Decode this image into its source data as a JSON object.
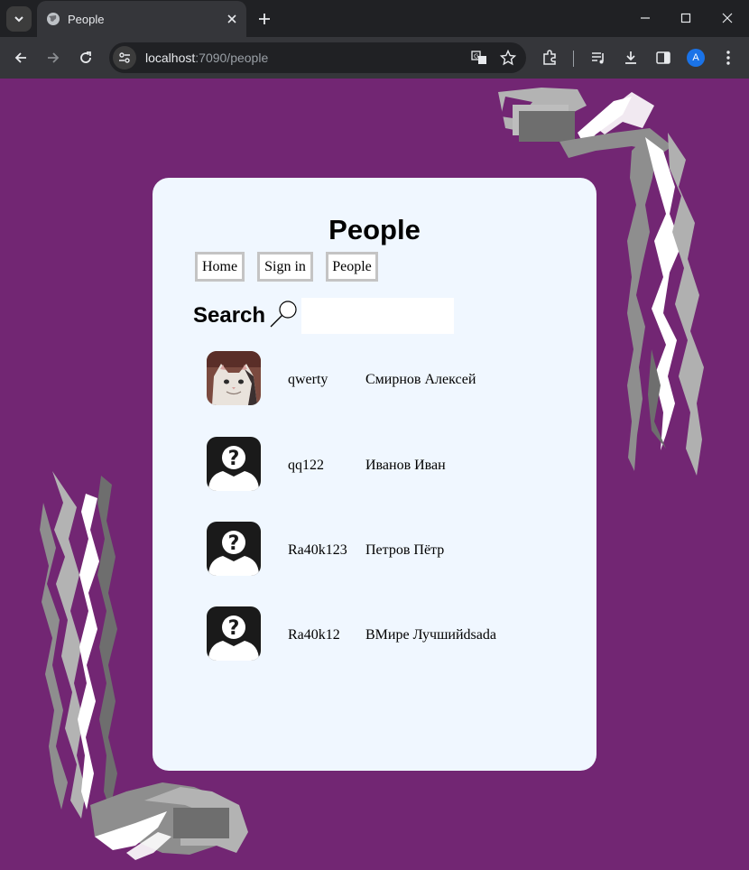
{
  "browser": {
    "tab_title": "People",
    "url_host": "localhost",
    "url_rest": ":7090/people",
    "profile_initial": "A"
  },
  "page": {
    "title": "People",
    "nav": [
      "Home",
      "Sign in",
      "People"
    ],
    "search_label": "Search",
    "search_value": ""
  },
  "people": [
    {
      "login": "qwerty",
      "name": "Смирнов Алексей",
      "avatar": "cat-photo"
    },
    {
      "login": "qq122",
      "name": "Иванов Иван",
      "avatar": "unknown-person-icon"
    },
    {
      "login": "Ra40k123",
      "name": "Петров Пётр",
      "avatar": "unknown-person-icon"
    },
    {
      "login": "Ra40k12",
      "name": "ВМире Лучшийdsada",
      "avatar": "unknown-person-icon"
    }
  ],
  "colors": {
    "page_bg": "#722673",
    "card_bg": "#f0f7ff",
    "nav_border": "#c4c4c4"
  }
}
